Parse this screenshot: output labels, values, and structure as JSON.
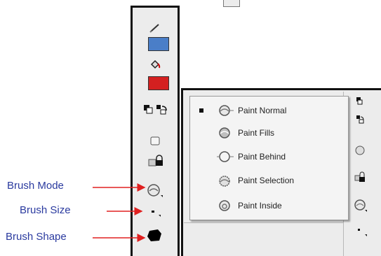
{
  "toolbar": {
    "stroke_color": "#4a7ec8",
    "fill_color": "#d42020"
  },
  "brush_mode_menu": {
    "items": [
      {
        "label": "Paint Normal",
        "checked": true
      },
      {
        "label": "Paint Fills",
        "checked": false
      },
      {
        "label": "Paint Behind",
        "checked": false
      },
      {
        "label": "Paint Selection",
        "checked": false
      },
      {
        "label": "Paint Inside",
        "checked": false
      }
    ]
  },
  "annotations": {
    "brush_mode": "Brush Mode",
    "brush_size": "Brush Size",
    "brush_shape": "Brush Shape",
    "color": "#2a3a9f",
    "arrow_color": "#e02020"
  }
}
